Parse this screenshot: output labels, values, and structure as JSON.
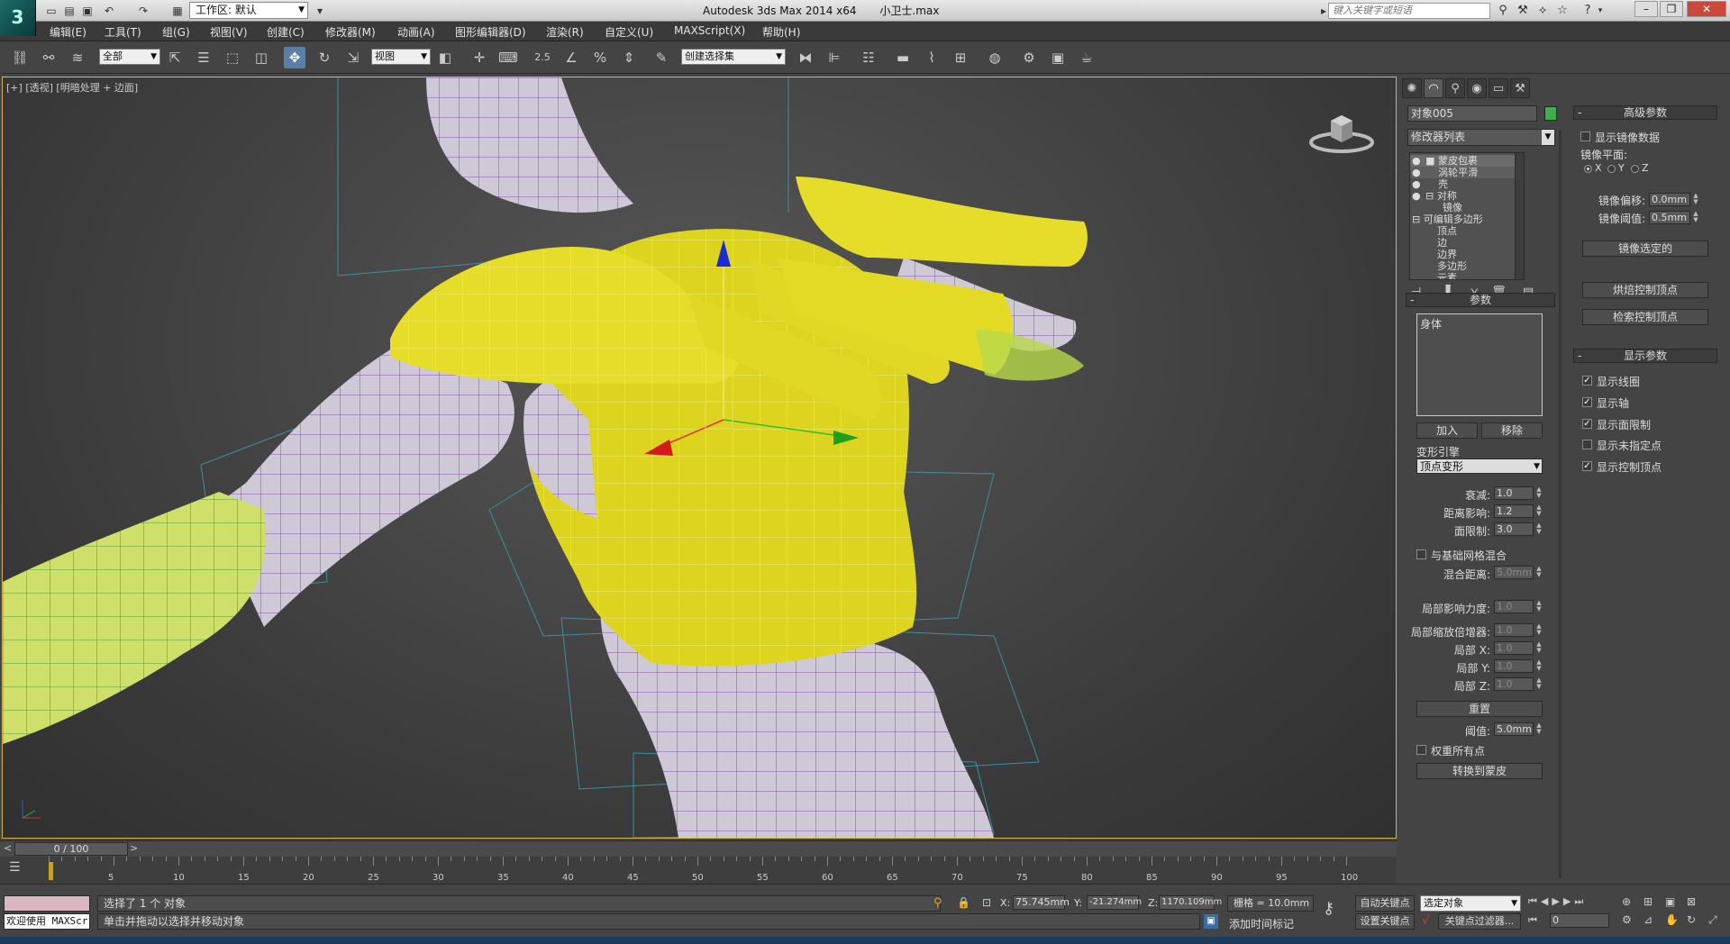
{
  "window": {
    "app_logo": "3",
    "workspace_label": "工作区: 默认",
    "title": "Autodesk 3ds Max  2014 x64",
    "filename": "小卫士.max",
    "search_placeholder": "键入关键字或短语",
    "minimize": "–",
    "restore": "❐",
    "close": "✕"
  },
  "menus": [
    "编辑(E)",
    "工具(T)",
    "组(G)",
    "视图(V)",
    "创建(C)",
    "修改器(M)",
    "动画(A)",
    "图形编辑器(D)",
    "渲染(R)",
    "自定义(U)",
    "MAXScript(X)",
    "帮助(H)"
  ],
  "toolbar": {
    "selection_filter": "全部",
    "ref_coord": "视图",
    "snap_value": "2.5",
    "named_selection": "创建选择集"
  },
  "viewport": {
    "label_plus": "[+]",
    "label_view": "[透视]",
    "label_shading": "[明暗处理 + 边面]"
  },
  "command_panel": {
    "object_name": "对象005",
    "object_color": "#3cb04a",
    "modifier_list": "修改器列表",
    "stack": [
      {
        "label": "蒙皮包裹",
        "selected": true
      },
      {
        "label": "涡轮平滑",
        "selected": false
      },
      {
        "label": "壳",
        "selected": false
      },
      {
        "label": "对称",
        "selected": false
      },
      {
        "label": "镜像",
        "selected": false
      },
      {
        "label": "可编辑多边形",
        "selected": false
      },
      {
        "label": "顶点",
        "selected": false
      },
      {
        "label": "边",
        "selected": false
      },
      {
        "label": "边界",
        "selected": false
      },
      {
        "label": "多边形",
        "selected": false
      },
      {
        "label": "元素",
        "selected": false
      }
    ],
    "params": {
      "header": "参数",
      "list_item": "身体",
      "add_button": "加入",
      "remove_button": "移除",
      "deform_engine_label": "变形引擎",
      "deform_engine_value": "顶点变形",
      "falloff_label": "衰减:",
      "falloff_value": "1.0",
      "distance_label": "距离影响:",
      "distance_value": "1.2",
      "face_limit_label": "面限制:",
      "face_limit_value": "3.0",
      "blend_base_label": "与基础网格混合",
      "blend_distance_label": "混合距离:",
      "blend_distance_value": "5.0mm",
      "local_strength_label": "局部影响力度:",
      "local_strength_value": "1.0",
      "local_scale_label": "局部缩放倍增器:",
      "local_scale_value": "1.0",
      "local_x_label": "局部 X:",
      "local_x_value": "1.0",
      "local_y_label": "局部 Y:",
      "local_y_value": "1.0",
      "local_z_label": "局部 Z:",
      "local_z_value": "1.0",
      "reset_button": "重置",
      "threshold_label": "阈值:",
      "threshold_value": "5.0mm",
      "weight_all_label": "权重所有点",
      "convert_button": "转换到蒙皮"
    },
    "advanced": {
      "header": "高级参数",
      "show_mirror_label": "显示镜像数据",
      "mirror_plane_label": "镜像平面:",
      "axis_x": "X",
      "axis_y": "Y",
      "axis_z": "Z",
      "mirror_offset_label": "镜像偏移:",
      "mirror_offset_value": "0.0mm",
      "mirror_threshold_label": "镜像阈值:",
      "mirror_threshold_value": "0.5mm",
      "mirror_selected_button": "镜像选定的",
      "bake_button": "烘焙控制顶点",
      "retrieve_button": "检索控制顶点"
    },
    "display": {
      "header": "显示参数",
      "items": [
        {
          "label": "显示线圈",
          "checked": true
        },
        {
          "label": "显示轴",
          "checked": true
        },
        {
          "label": "显示面限制",
          "checked": true
        },
        {
          "label": "显示未指定点",
          "checked": false
        },
        {
          "label": "显示控制顶点",
          "checked": true
        }
      ]
    }
  },
  "timeline": {
    "frame_display": "0 / 100",
    "prev": "<",
    "next": ">",
    "ticks": [
      "5",
      "10",
      "15",
      "20",
      "25",
      "30",
      "35",
      "40",
      "45",
      "50",
      "55",
      "60",
      "65",
      "70",
      "75",
      "80",
      "85",
      "90",
      "95",
      "100"
    ]
  },
  "status": {
    "maxscript_label": "欢迎使用 MAXScr",
    "selection_text": "选择了 1 个 对象",
    "prompt_text": "单击并拖动以选择并移动对象",
    "x_label": "X:",
    "x_value": "75.745mm",
    "y_label": "Y:",
    "y_value": "-21.274mm",
    "z_label": "Z:",
    "z_value": "1170.109mm",
    "grid_text": "栅格 = 10.0mm",
    "add_time_tag": "添加时间标记",
    "auto_key": "自动关键点",
    "set_key": "设置关键点",
    "selected_object": "选定对象",
    "key_filters": "关键点过滤器...",
    "frame_value": "0"
  }
}
